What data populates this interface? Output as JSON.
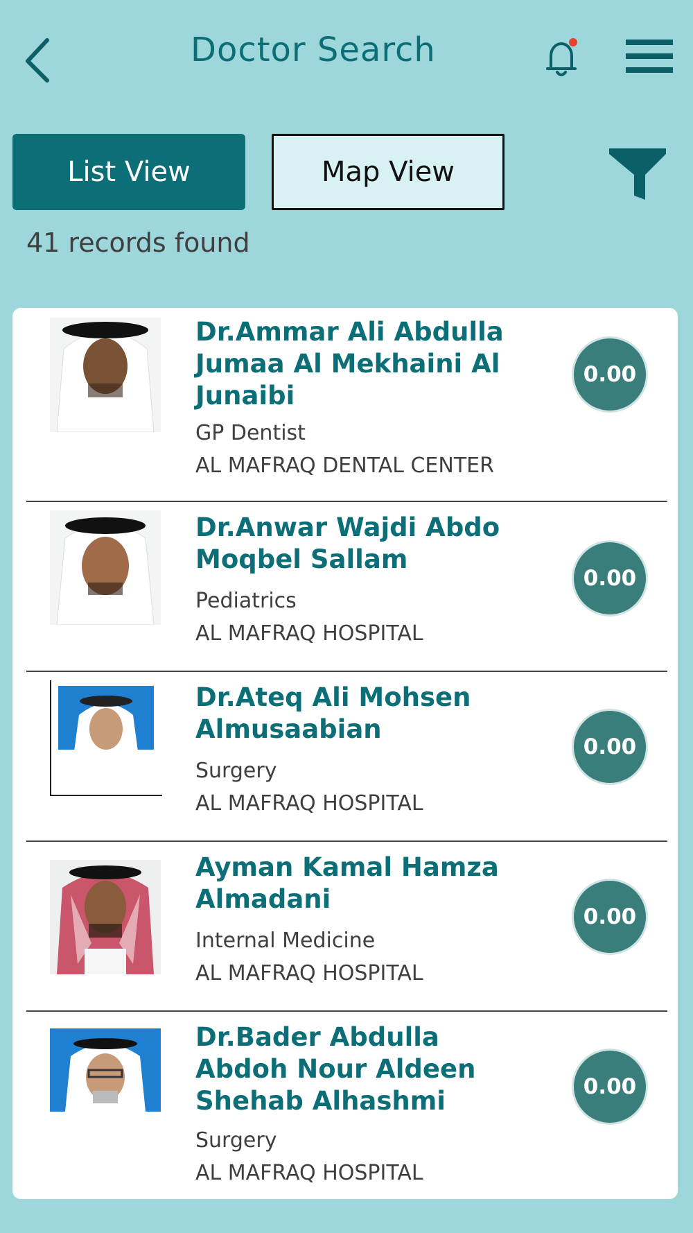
{
  "header": {
    "title": "Doctor Search"
  },
  "views": {
    "list_label": "List View",
    "map_label": "Map View",
    "active": "List View"
  },
  "records_text": "41 records found",
  "doctors": [
    {
      "name": "Dr.Ammar Ali Abdulla Jumaa Al Mekhaini Al Junaibi",
      "specialty": "GP Dentist",
      "facility": "AL MAFRAQ DENTAL CENTER",
      "rating": "0.00"
    },
    {
      "name": "Dr.Anwar Wajdi Abdo Moqbel Sallam",
      "specialty": "Pediatrics",
      "facility": "AL MAFRAQ HOSPITAL",
      "rating": "0.00"
    },
    {
      "name": "Dr.Ateq Ali Mohsen Almusaabian",
      "specialty": "Surgery",
      "facility": "AL MAFRAQ HOSPITAL",
      "rating": "0.00"
    },
    {
      "name": "Ayman Kamal Hamza Almadani",
      "specialty": "Internal Medicine",
      "facility": "AL MAFRAQ HOSPITAL",
      "rating": "0.00"
    },
    {
      "name": "Dr.Bader Abdulla Abdoh Nour Aldeen Shehab Alhashmi",
      "specialty": "Surgery",
      "facility": "AL MAFRAQ HOSPITAL",
      "rating": "0.00"
    }
  ],
  "icons": {
    "back": "chevron-left-icon",
    "notifications": "bell-icon",
    "menu": "hamburger-menu-icon",
    "filter": "filter-icon"
  },
  "colors": {
    "background": "#9dd6db",
    "accent": "#0c6f77",
    "rating_badge": "#3a7e7b",
    "notification_dot": "#e2442f"
  }
}
